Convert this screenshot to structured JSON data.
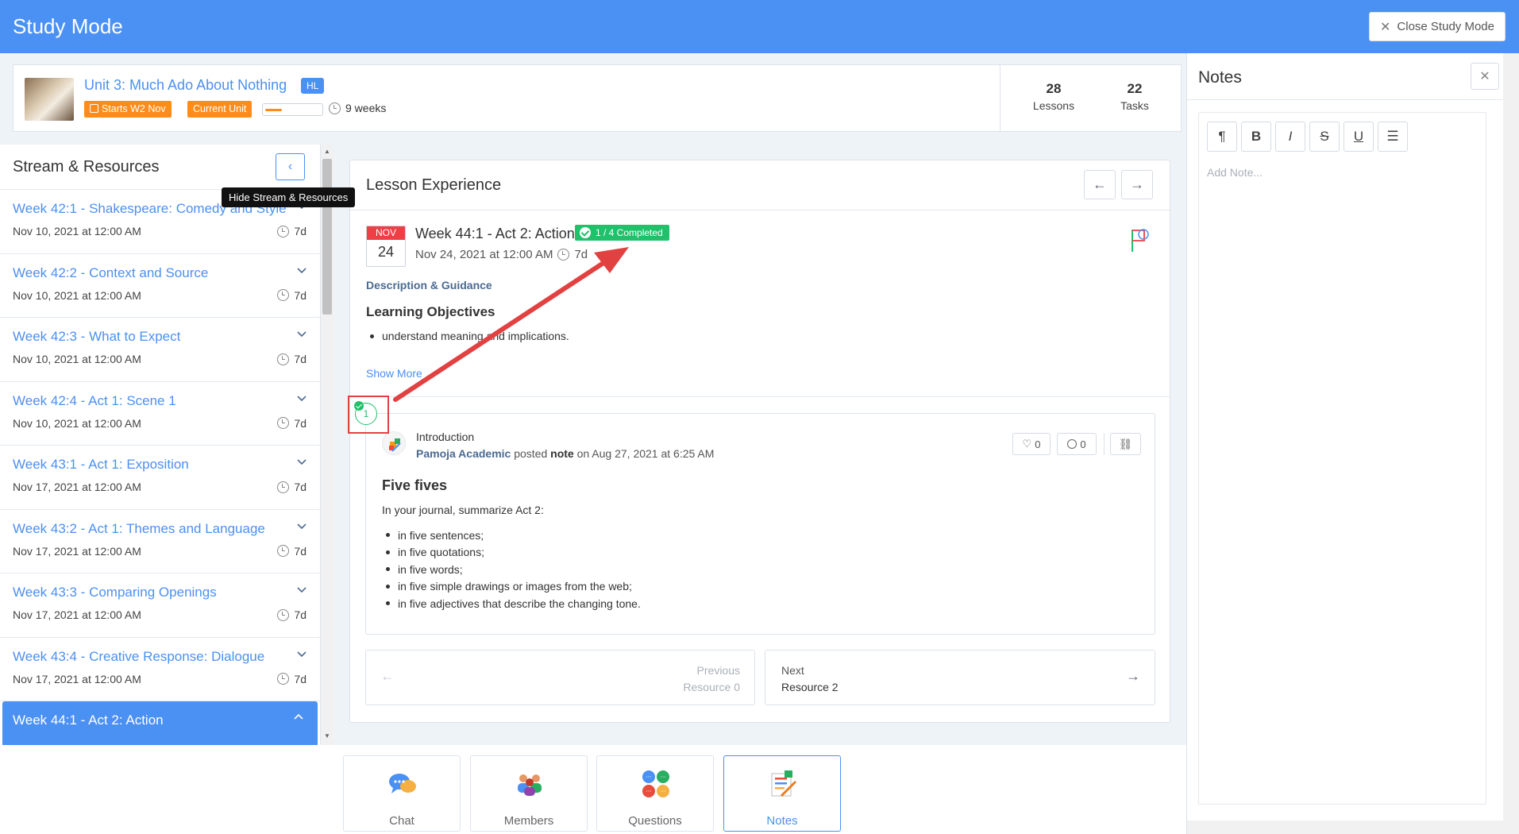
{
  "header": {
    "title": "Study Mode",
    "close_label": "Close Study Mode"
  },
  "unit": {
    "title": "Unit 3: Much Ado About Nothing",
    "level_badge": "HL",
    "start_badge": "Starts W2 Nov",
    "current_badge": "Current Unit",
    "progress": 0.3,
    "duration": "9 weeks",
    "lessons_count": "28",
    "lessons_label": "Lessons",
    "tasks_count": "22",
    "tasks_label": "Tasks"
  },
  "stream": {
    "title": "Stream & Resources",
    "hide_tooltip": "Hide Stream & Resources",
    "items": [
      {
        "title": "Week 42:1 - Shakespeare: Comedy and Style",
        "date": "Nov 10, 2021 at 12:00 AM",
        "duration": "7d"
      },
      {
        "title": "Week 42:2 - Context and Source",
        "date": "Nov 10, 2021 at 12:00 AM",
        "duration": "7d"
      },
      {
        "title": "Week 42:3 - What to Expect",
        "date": "Nov 10, 2021 at 12:00 AM",
        "duration": "7d"
      },
      {
        "title": "Week 42:4 - Act 1: Scene 1",
        "date": "Nov 10, 2021 at 12:00 AM",
        "duration": "7d"
      },
      {
        "title": "Week 43:1 - Act 1: Exposition",
        "date": "Nov 17, 2021 at 12:00 AM",
        "duration": "7d"
      },
      {
        "title": "Week 43:2 - Act 1: Themes and Language",
        "date": "Nov 17, 2021 at 12:00 AM",
        "duration": "7d"
      },
      {
        "title": "Week 43:3 - Comparing Openings",
        "date": "Nov 17, 2021 at 12:00 AM",
        "duration": "7d"
      },
      {
        "title": "Week 43:4 - Creative Response: Dialogue",
        "date": "Nov 17, 2021 at 12:00 AM",
        "duration": "7d"
      },
      {
        "title": "Week 44:1 - Act 2: Action",
        "date": "",
        "duration": ""
      }
    ]
  },
  "lesson": {
    "header": "Lesson Experience",
    "month": "NOV",
    "day": "24",
    "week_title": "Week 44:1 - Act 2: Action",
    "completed": "1 / 4 Completed",
    "date": "Nov 24, 2021 at 12:00 AM",
    "duration": "7d",
    "desc_title": "Description & Guidance",
    "objectives_title": "Learning Objectives",
    "objective": "understand meaning and implications.",
    "show_more": "Show More"
  },
  "resource": {
    "number": "1",
    "type": "Introduction",
    "author": "Pamoja Academic",
    "posted": "posted",
    "kind": "note",
    "when": "on Aug 27, 2021 at 6:25 AM",
    "likes": "0",
    "comments": "0",
    "heading": "Five fives",
    "intro": "In your journal, summarize Act 2:",
    "items": [
      "in five sentences;",
      "in five quotations;",
      "in five words;",
      "in five simple drawings or images from the web;",
      "in five adjectives that describe the changing tone."
    ]
  },
  "pager": {
    "prev_label": "Previous",
    "prev_res": "Resource 0",
    "next_label": "Next",
    "next_res": "Resource 2"
  },
  "tabs": {
    "chat": "Chat",
    "members": "Members",
    "questions": "Questions",
    "notes": "Notes"
  },
  "notes": {
    "title": "Notes",
    "placeholder": "Add Note..."
  },
  "colors": {
    "primary": "#4b90f3",
    "orange": "#ff8c1a",
    "green": "#21c06a",
    "red_annotation": "#e24141"
  }
}
